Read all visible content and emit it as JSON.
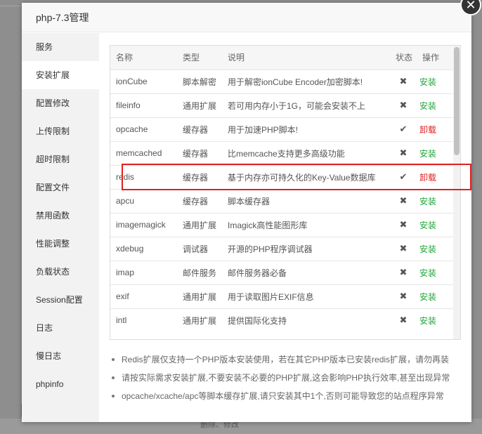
{
  "background": {
    "bottom_text": "删除、修改"
  },
  "dialog": {
    "title": "php-7.3管理",
    "close_symbol": "✕"
  },
  "sidebar": {
    "items": [
      {
        "label": "服务"
      },
      {
        "label": "安装扩展"
      },
      {
        "label": "配置修改"
      },
      {
        "label": "上传限制"
      },
      {
        "label": "超时限制"
      },
      {
        "label": "配置文件"
      },
      {
        "label": "禁用函数"
      },
      {
        "label": "性能调整"
      },
      {
        "label": "负载状态"
      },
      {
        "label": "Session配置"
      },
      {
        "label": "日志"
      },
      {
        "label": "慢日志"
      },
      {
        "label": "phpinfo"
      }
    ],
    "active_index": 1
  },
  "table": {
    "headers": {
      "name": "名称",
      "type": "类型",
      "desc": "说明",
      "status": "状态",
      "op": "操作"
    },
    "rows": [
      {
        "name": "ionCube",
        "type": "脚本解密",
        "desc": "用于解密ionCube Encoder加密脚本!",
        "status": "✖",
        "op": "安装"
      },
      {
        "name": "fileinfo",
        "type": "通用扩展",
        "desc": "若可用内存小于1G，可能会安装不上",
        "status": "✖",
        "op": "安装"
      },
      {
        "name": "opcache",
        "type": "缓存器",
        "desc": "用于加速PHP脚本!",
        "status": "✔",
        "op": "卸载"
      },
      {
        "name": "memcached",
        "type": "缓存器",
        "desc": "比memcache支持更多高级功能",
        "status": "✖",
        "op": "安装"
      },
      {
        "name": "redis",
        "type": "缓存器",
        "desc": "基于内存亦可持久化的Key-Value数据库",
        "status": "✔",
        "op": "卸载"
      },
      {
        "name": "apcu",
        "type": "缓存器",
        "desc": "脚本缓存器",
        "status": "✖",
        "op": "安装"
      },
      {
        "name": "imagemagick",
        "type": "通用扩展",
        "desc": "Imagick高性能图形库",
        "status": "✖",
        "op": "安装"
      },
      {
        "name": "xdebug",
        "type": "调试器",
        "desc": "开源的PHP程序调试器",
        "status": "✖",
        "op": "安装"
      },
      {
        "name": "imap",
        "type": "邮件服务",
        "desc": "邮件服务器必备",
        "status": "✖",
        "op": "安装"
      },
      {
        "name": "exif",
        "type": "通用扩展",
        "desc": "用于读取图片EXIF信息",
        "status": "✖",
        "op": "安装"
      },
      {
        "name": "intl",
        "type": "通用扩展",
        "desc": "提供国际化支持",
        "status": "✖",
        "op": "安装"
      }
    ],
    "highlighted_row": "redis"
  },
  "notes": [
    "Redis扩展仅支持一个PHP版本安装使用，若在其它PHP版本已安装redis扩展，请勿再装",
    "请按实际需求安装扩展,不要安装不必要的PHP扩展,这会影响PHP执行效率,甚至出现异常",
    "opcache/xcache/apc等脚本缓存扩展,请只安装其中1个,否则可能导致您的站点程序异常"
  ],
  "colors": {
    "install": "#20a53a",
    "uninstall": "#e02020",
    "highlight": "#e02020"
  },
  "icons": {
    "installed": "check-icon",
    "not_installed": "cross-icon",
    "close": "close-icon"
  }
}
